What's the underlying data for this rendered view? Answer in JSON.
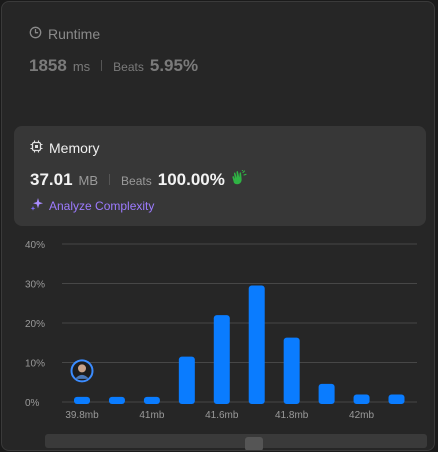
{
  "runtime": {
    "title": "Runtime",
    "value": "1858",
    "unit": "ms",
    "beats_label": "Beats",
    "beats_value": "5.95%"
  },
  "memory": {
    "title": "Memory",
    "value": "37.01",
    "unit": "MB",
    "beats_label": "Beats",
    "beats_value": "100.00%",
    "analyze_label": "Analyze Complexity"
  },
  "colors": {
    "bar": "#0a7cff",
    "analyze": "#9d7bff",
    "clap": "#2fb344"
  },
  "icons": [
    "clock-icon",
    "chip-icon",
    "sparkle-icon",
    "clap-icon",
    "avatar"
  ],
  "chart_data": {
    "type": "bar",
    "y_ticks": [
      "40%",
      "30%",
      "20%",
      "10%",
      "0%"
    ],
    "x_ticks": [
      "39.8mb",
      "41mb",
      "41.6mb",
      "41.8mb",
      "42mb"
    ],
    "ylim": [
      0,
      40
    ],
    "values": [
      1.3,
      1.3,
      1.3,
      11.5,
      22,
      29.5,
      16.3,
      4.6,
      1.9,
      1.9
    ],
    "highlight_index": 0,
    "grid": true
  }
}
